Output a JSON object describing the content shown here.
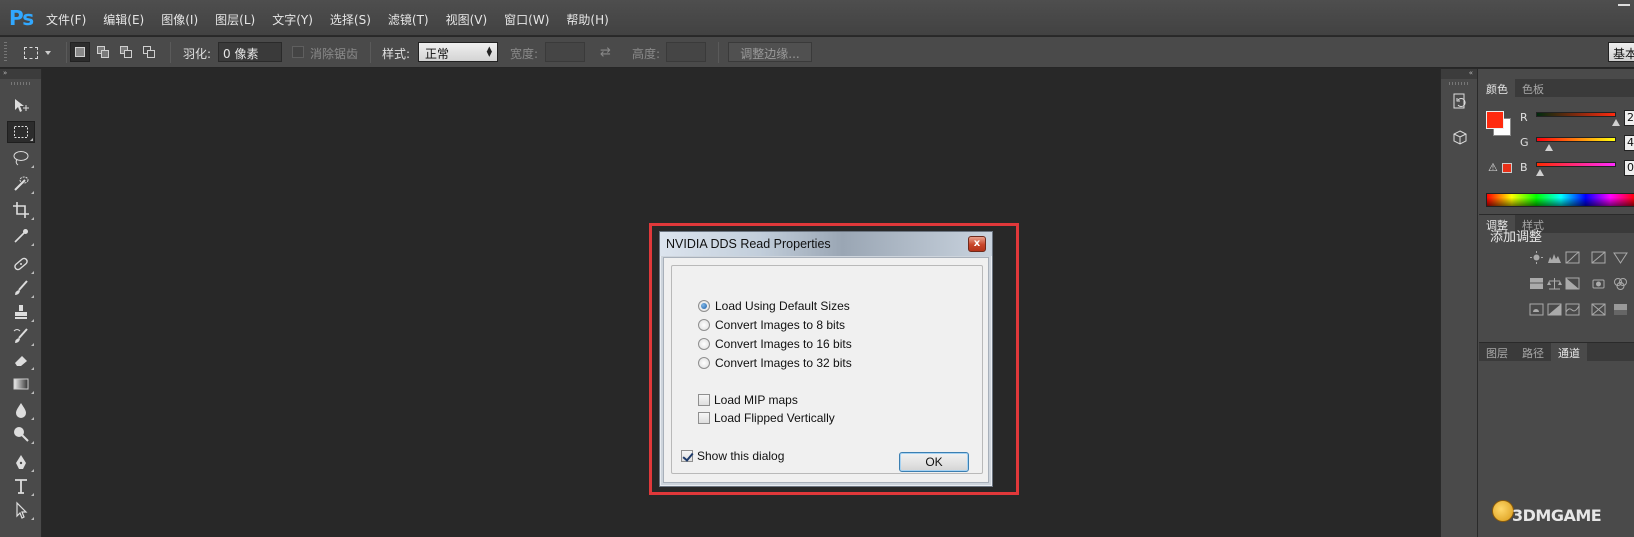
{
  "app": {
    "logo": "Ps"
  },
  "menu": [
    "文件(F)",
    "编辑(E)",
    "图像(I)",
    "图层(L)",
    "文字(Y)",
    "选择(S)",
    "滤镜(T)",
    "视图(V)",
    "窗口(W)",
    "帮助(H)"
  ],
  "options": {
    "feather_label": "羽化:",
    "feather_value": "0 像素",
    "antialias_label": "消除锯齿",
    "style_label": "样式:",
    "style_value": "正常",
    "width_label": "宽度:",
    "height_label": "高度:",
    "refine_edge": "调整边缘...",
    "workspace_button": "基本"
  },
  "tools": [
    "move-tool",
    "marquee-tool",
    "lasso-tool",
    "quick-selection-tool",
    "crop-tool",
    "eyedropper-tool",
    "healing-brush-tool",
    "brush-tool",
    "clone-stamp-tool",
    "history-brush-tool",
    "eraser-tool",
    "gradient-tool",
    "blur-tool",
    "dodge-tool",
    "pen-tool",
    "type-tool",
    "path-selection-tool"
  ],
  "tools_active": "marquee-tool",
  "dialog": {
    "title": "NVIDIA DDS Read Properties",
    "close": "x",
    "radios": [
      {
        "label": "Load Using Default Sizes",
        "checked": true
      },
      {
        "label": "Convert Images to 8 bits",
        "checked": false
      },
      {
        "label": "Convert Images to  16 bits",
        "checked": false
      },
      {
        "label": "Convert Images to 32 bits",
        "checked": false
      }
    ],
    "checkboxes": [
      {
        "label": "Load MIP maps",
        "checked": false
      },
      {
        "label": "Load Flipped Vertically",
        "checked": false
      }
    ],
    "show_dialog": {
      "label": "Show this dialog",
      "checked": true
    },
    "ok": "OK"
  },
  "color_panel": {
    "tabs": [
      "颜色",
      "色板"
    ],
    "active_tab": "颜色",
    "foreground": "#ff2a0e",
    "background": "#ffffff",
    "channels": [
      {
        "label": "R",
        "value": "2",
        "gradient": "linear-gradient(90deg,#002a0e,#ff2a0e)",
        "level": 1.0
      },
      {
        "label": "G",
        "value": "4",
        "gradient": "linear-gradient(90deg,#ff000e,#ffff0e)",
        "level": 0.16
      },
      {
        "label": "B",
        "value": "0",
        "gradient": "linear-gradient(90deg,#ff2a00,#ff2aff)",
        "level": 0.05
      }
    ]
  },
  "adjustments_panel": {
    "tabs": [
      "调整",
      "样式"
    ],
    "active_tab": "调整",
    "title": "添加调整",
    "icons": [
      "brightness-icon",
      "levels-icon",
      "curves-icon",
      "exposure-icon",
      "vibrance-icon",
      "hue-saturation-icon",
      "color-balance-icon",
      "black-white-icon",
      "photo-filter-icon",
      "channel-mixer-icon",
      "invert-icon",
      "posterize-icon",
      "threshold-icon",
      "selective-color-icon",
      "gradient-map-icon"
    ]
  },
  "layers_panel": {
    "tabs": [
      "图层",
      "路径",
      "通道"
    ],
    "active_tab": "通道"
  },
  "watermark": "3DMGAME"
}
